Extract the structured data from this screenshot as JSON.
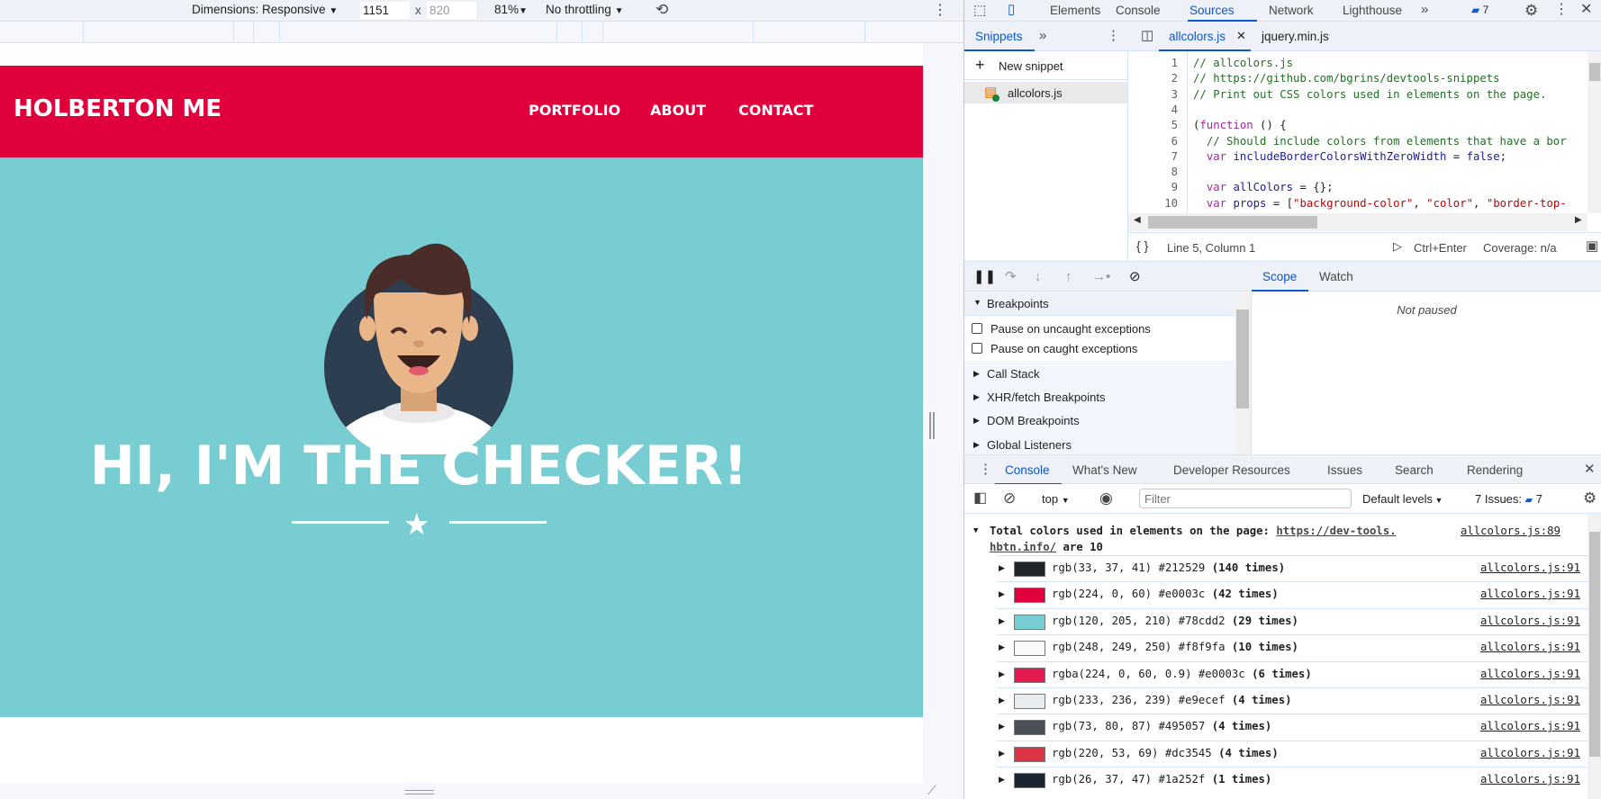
{
  "device_toolbar": {
    "dimensions_label": "Dimensions: Responsive",
    "width": "1151",
    "height_placeholder": "820",
    "zoom": "81%",
    "throttling": "No throttling",
    "icons": [
      "dropdown-icon",
      "rotate-icon",
      "more-vert-icon"
    ]
  },
  "site": {
    "logo": "HOLBERTON ME",
    "nav": [
      "PORTFOLIO",
      "ABOUT",
      "CONTACT"
    ],
    "heading": "HI, I'M THE CHECKER!",
    "colors": {
      "primary": "#e0003c",
      "hero": "#78cdd2",
      "dark": "#2d3e50"
    }
  },
  "devtools": {
    "main_tabs": [
      "Elements",
      "Console",
      "Sources",
      "Network",
      "Lighthouse"
    ],
    "active_tab": "Sources",
    "issues_count": "7",
    "navigator_tab": "Snippets",
    "new_snippet": "New snippet",
    "snippet_file": "allcolors.js",
    "editor_tabs": [
      "allcolors.js",
      "jquery.min.js"
    ],
    "code_lines": [
      [
        [
          "cm",
          "// allcolors.js"
        ]
      ],
      [
        [
          "cm",
          "// https://github.com/bgrins/devtools-snippets"
        ]
      ],
      [
        [
          "cm",
          "// Print out CSS colors used in elements on the page."
        ]
      ],
      [],
      [
        [
          "pl",
          "("
        ],
        [
          "kw",
          "function"
        ],
        [
          "pl",
          " () {"
        ]
      ],
      [
        [
          "pl",
          "  "
        ],
        [
          "cm",
          "// Should include colors from elements that have a bor"
        ]
      ],
      [
        [
          "pl",
          "  "
        ],
        [
          "kw",
          "var"
        ],
        [
          "pl",
          " "
        ],
        [
          "vr",
          "includeBorderColorsWithZeroWidth"
        ],
        [
          "pl",
          " = "
        ],
        [
          "vr",
          "false"
        ],
        [
          "pl",
          ";"
        ]
      ],
      [],
      [
        [
          "pl",
          "  "
        ],
        [
          "kw",
          "var"
        ],
        [
          "pl",
          " "
        ],
        [
          "vr",
          "allColors"
        ],
        [
          "pl",
          " = {};"
        ]
      ],
      [
        [
          "pl",
          "  "
        ],
        [
          "kw",
          "var"
        ],
        [
          "pl",
          " "
        ],
        [
          "vr",
          "props"
        ],
        [
          "pl",
          " = ["
        ],
        [
          "st",
          "\"background-color\""
        ],
        [
          "pl",
          ", "
        ],
        [
          "st",
          "\"color\""
        ],
        [
          "pl",
          ", "
        ],
        [
          "st",
          "\"border-top-"
        ]
      ]
    ],
    "status": {
      "position": "Line 5, Column 1",
      "run": "Ctrl+Enter",
      "coverage": "Coverage: n/a"
    },
    "debugger": {
      "breakpoints_header": "Breakpoints",
      "checkboxes": [
        "Pause on uncaught exceptions",
        "Pause on caught exceptions"
      ],
      "sections": [
        "Call Stack",
        "XHR/fetch Breakpoints",
        "DOM Breakpoints",
        "Global Listeners"
      ],
      "right_tabs": [
        "Scope",
        "Watch"
      ],
      "not_paused": "Not paused"
    },
    "drawer_tabs": [
      "Console",
      "What's New",
      "Developer Resources",
      "Issues",
      "Search",
      "Rendering"
    ],
    "console_toolbar": {
      "context": "top",
      "filter_placeholder": "Filter",
      "levels": "Default levels",
      "issues_label": "7 Issues:",
      "issues_count": "7"
    },
    "console": {
      "group_text": "Total colors used in elements on the page:",
      "group_link": "https://dev-tools.hbtn.info/",
      "group_link_1": "https://dev-tools.",
      "group_link_2": "hbtn.info/",
      "group_suffix": "are 10",
      "group_source": "allcolors.js:89",
      "rows": [
        {
          "swatch": "#212529",
          "text": "rgb(33, 37, 41) #212529",
          "count": "(140 times)",
          "source": "allcolors.js:91"
        },
        {
          "swatch": "#e0003c",
          "text": "rgb(224, 0, 60) #e0003c",
          "count": "(42 times)",
          "source": "allcolors.js:91"
        },
        {
          "swatch": "#78cdd2",
          "text": "rgb(120, 205, 210) #78cdd2",
          "count": "(29 times)",
          "source": "allcolors.js:91"
        },
        {
          "swatch": "#f8f9fa",
          "text": "rgb(248, 249, 250) #f8f9fa",
          "count": "(10 times)",
          "source": "allcolors.js:91"
        },
        {
          "swatch": "#e3194f",
          "text": "rgba(224, 0, 60, 0.9) #e0003c",
          "count": "(6 times)",
          "source": "allcolors.js:91"
        },
        {
          "swatch": "#e9ecef",
          "text": "rgb(233, 236, 239) #e9ecef",
          "count": "(4 times)",
          "source": "allcolors.js:91"
        },
        {
          "swatch": "#495057",
          "text": "rgb(73, 80, 87) #495057",
          "count": "(4 times)",
          "source": "allcolors.js:91"
        },
        {
          "swatch": "#dc3545",
          "text": "rgb(220, 53, 69) #dc3545",
          "count": "(4 times)",
          "source": "allcolors.js:91"
        },
        {
          "swatch": "#1a252f",
          "text": "rgb(26, 37, 47) #1a252f",
          "count": "(1 times)",
          "source": "allcolors.js:91"
        }
      ]
    }
  }
}
